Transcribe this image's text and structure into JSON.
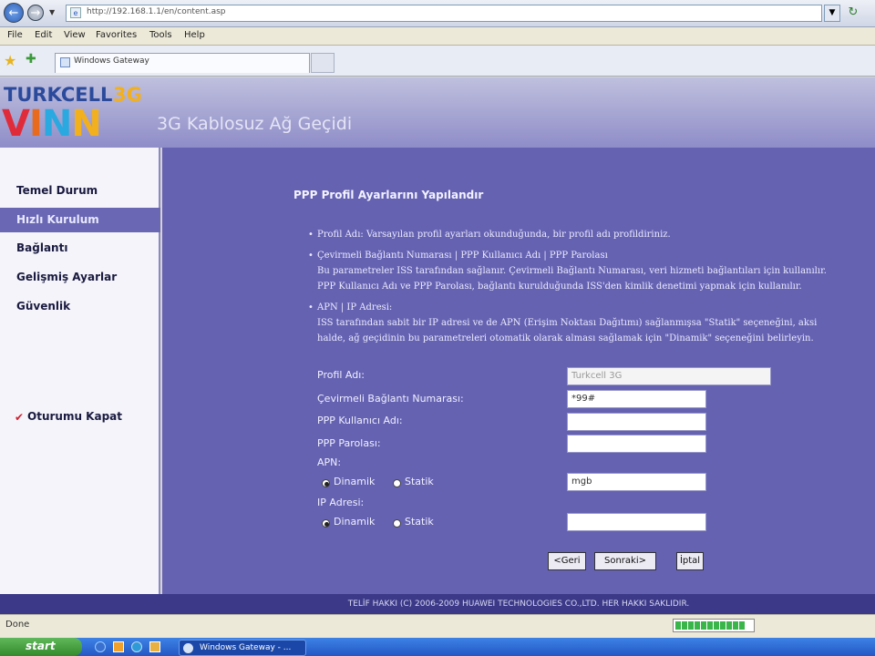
{
  "browser": {
    "url": "http://192.168.1.1/en/content.asp",
    "menu": [
      "File",
      "Edit",
      "View",
      "Favorites",
      "Tools",
      "Help"
    ],
    "tab_title": "Windows Gateway",
    "status_text": "Done"
  },
  "header": {
    "brand_top": "TURKCELL",
    "brand_3g": "3G",
    "brand_vinn": [
      "V",
      "I",
      "N",
      "N"
    ],
    "title": "3G Kablosuz Ağ Geçidi"
  },
  "sidebar": {
    "items": [
      {
        "label": "Temel Durum"
      },
      {
        "label": "Hızlı Kurulum",
        "active": true
      },
      {
        "label": "Bağlantı"
      },
      {
        "label": "Gelişmiş Ayarlar"
      },
      {
        "label": "Güvenlik"
      }
    ],
    "logout": "Oturumu Kapat"
  },
  "main": {
    "title": "PPP Profil Ayarlarını Yapılandır",
    "help": [
      "Profil Adı: Varsayılan profil ayarları okunduğunda, bir profil adı profildiriniz.",
      "Çevirmeli Bağlantı Numarası | PPP Kullanıcı Adı | PPP Parolası",
      "Bu parametreler ISS tarafından sağlanır. Çevirmeli Bağlantı Numarası, veri hizmeti bağlantıları için kullanılır.",
      "PPP Kullanıcı Adı ve PPP Parolası, bağlantı kurulduğunda ISS'den kimlik denetimi yapmak için kullanılır.",
      "APN | IP Adresi:",
      "ISS tarafından sabit bir IP adresi ve de APN (Erişim Noktası Dağıtımı) sağlanmışsa \"Statik\" seçeneğini, aksi",
      "halde, ağ geçidinin bu parametreleri otomatik olarak alması sağlamak için \"Dinamik\" seçeneğini belirleyin."
    ],
    "form": {
      "profile_name_label": "Profil Adı:",
      "profile_name_value": "Turkcell 3G",
      "dial_number_label": "Çevirmeli Bağlantı Numarası:",
      "dial_number_value": "*99#",
      "ppp_user_label": "PPP Kullanıcı Adı:",
      "ppp_user_value": "",
      "ppp_pass_label": "PPP Parolası:",
      "ppp_pass_value": "",
      "apn_label": "APN:",
      "apn_dynamic": "Dinamik",
      "apn_static": "Statik",
      "apn_value": "mgb",
      "ip_label": "IP Adresi:",
      "ip_dynamic": "Dinamik",
      "ip_static": "Statik",
      "ip_value": ""
    },
    "buttons": {
      "back": "<Geri",
      "next": "Sonraki>",
      "cancel": "İptal"
    }
  },
  "footer": "TELİF HAKKI (C) 2006-2009 HUAWEI TECHNOLOGIES CO.,LTD. HER HAKKI SAKLIDIR.",
  "taskbar": {
    "start": "start",
    "window_button": "Windows Gateway - ..."
  },
  "colors": {
    "main_bg": "#6562b2",
    "sidebar_active": "#6a67b4",
    "footer_bg": "#3c3a88"
  }
}
